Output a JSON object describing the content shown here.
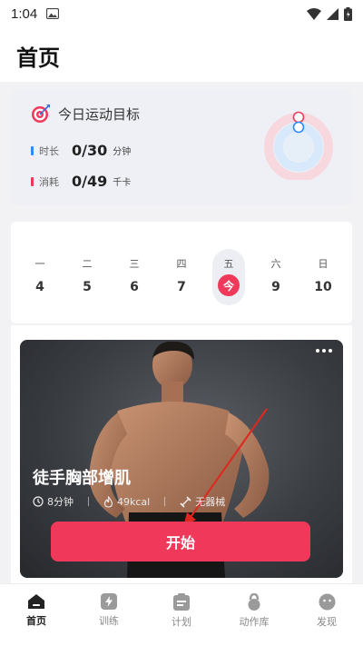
{
  "status_bar": {
    "time": "1:04"
  },
  "header": {
    "title": "首页"
  },
  "goal": {
    "title": "今日运动目标",
    "duration": {
      "label": "时长",
      "value": "0/30",
      "unit": "分钟",
      "color": "#2a8cff"
    },
    "calories": {
      "label": "消耗",
      "value": "0/49",
      "unit": "千卡",
      "color": "#f0395a"
    }
  },
  "week": {
    "days": [
      {
        "weekday": "一",
        "date": "4"
      },
      {
        "weekday": "二",
        "date": "5"
      },
      {
        "weekday": "三",
        "date": "6"
      },
      {
        "weekday": "四",
        "date": "7"
      },
      {
        "weekday": "五",
        "date": "今"
      },
      {
        "weekday": "六",
        "date": "9"
      },
      {
        "weekday": "日",
        "date": "10"
      }
    ]
  },
  "workout": {
    "title": "徒手胸部增肌",
    "duration": "8分钟",
    "calories": "49kcal",
    "equipment": "无器械",
    "start_label": "开始"
  },
  "tabs": [
    {
      "label": "首页",
      "icon": "home-icon",
      "active": true
    },
    {
      "label": "训练",
      "icon": "lightning-icon",
      "active": false
    },
    {
      "label": "计划",
      "icon": "clipboard-icon",
      "active": false
    },
    {
      "label": "动作库",
      "icon": "kettlebell-icon",
      "active": false
    },
    {
      "label": "发现",
      "icon": "discover-icon",
      "active": false
    }
  ],
  "colors": {
    "accent": "#f0395a",
    "blue": "#2a8cff"
  }
}
